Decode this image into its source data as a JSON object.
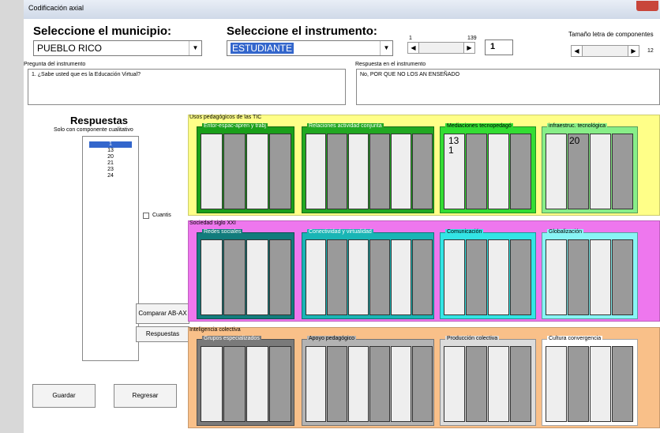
{
  "window": {
    "title": "Codificación axial"
  },
  "municipio": {
    "label": "Seleccione el municipio:",
    "value": "PUEBLO RICO"
  },
  "instrumento": {
    "label": "Seleccione el instrumento:",
    "value": "ESTUDIANTE"
  },
  "scroller": {
    "min": "1",
    "max": "139",
    "value": "1"
  },
  "font_size": {
    "label": "Tamaño letra de componentes",
    "value": "12"
  },
  "pregunta": {
    "label": "Pregunta del instrumento",
    "text": "1. ¿Sabe usted que es la Educación Virtual?"
  },
  "respuesta": {
    "label": "Respuesta en el instrumento",
    "text": "No, POR QUE NO LOS AN ENSEÑADO"
  },
  "respuestas": {
    "title": "Respuestas",
    "subtitle": "Solo con componente cualitativo",
    "items": [
      "1",
      "13",
      "20",
      "21",
      "23",
      "24"
    ]
  },
  "checkbox": {
    "label": "Cuantis"
  },
  "buttons": {
    "comparar": "Comparar AB-AX",
    "respuestas": "Respuestas",
    "guardar": "Guardar",
    "regresar": "Regresar"
  },
  "categories": [
    {
      "label": "Usos pedagógicos de las TIC",
      "color": "#ffff88",
      "groups": [
        {
          "label": "Entor-espac-apren y trabj",
          "color": "#1a9f1a",
          "values": []
        },
        {
          "label": "Relaciones actividad conjunta",
          "color": "#22a822",
          "values": []
        },
        {
          "label": "Mediaciones tecnopedagó",
          "color": "#33dd33",
          "values": [
            "13",
            "1"
          ]
        },
        {
          "label": "infraestruc. tecnológica",
          "color": "#88ee88",
          "values": [
            "20"
          ]
        }
      ]
    },
    {
      "label": "Sociedad siglo XXI",
      "color": "#ee77ee",
      "groups": [
        {
          "label": "Redes sociales",
          "color": "#127c7c",
          "values": []
        },
        {
          "label": "Conectividad y virtualidad",
          "color": "#19b5b5",
          "values": []
        },
        {
          "label": "Comunicación",
          "color": "#33e5e5",
          "values": []
        },
        {
          "label": "Globalización",
          "color": "#88f5f5",
          "values": []
        }
      ]
    },
    {
      "label": "Inteligencia colectiva",
      "color": "#f9c089",
      "groups": [
        {
          "label": "Grupos especializados",
          "color": "#7a7a7a",
          "values": []
        },
        {
          "label": "Apoyo pedagógico",
          "color": "#b3b3b3",
          "values": []
        },
        {
          "label": "Producción colectiva",
          "color": "#dcdcdc",
          "values": []
        },
        {
          "label": "Cultura convergencia",
          "color": "#ffffff",
          "values": []
        }
      ]
    }
  ]
}
